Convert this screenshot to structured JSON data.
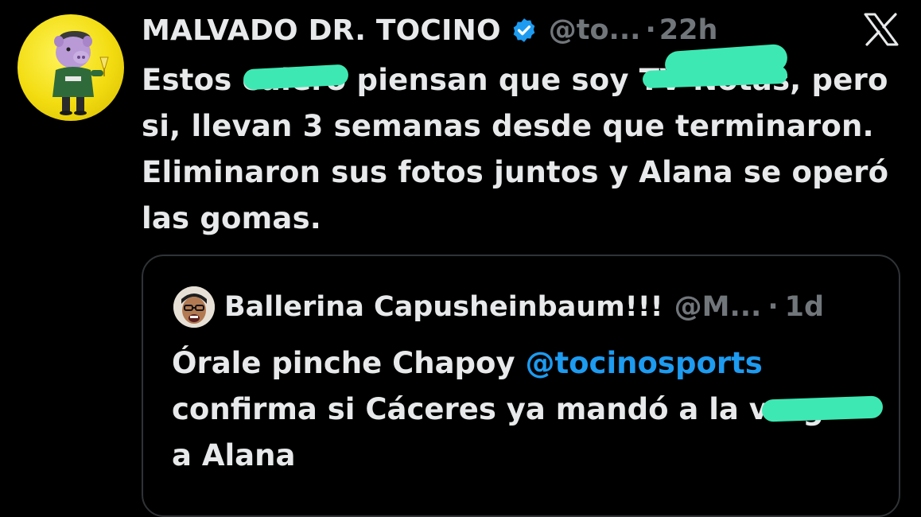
{
  "tweet": {
    "author_name": "MALVADO DR. TOCINO",
    "author_handle": "@to...",
    "separator": "·",
    "time": "22h",
    "verified_icon": "verified-badge-icon",
    "text_lines": [
      "Estos culero piensan que soy TV Notas, pero",
      "si, llevan 3 semanas desde que terminaron.",
      "Eliminaron sus fotos juntos y Alana se operó",
      "las gomas."
    ]
  },
  "platform": {
    "logo_icon": "x-logo-icon"
  },
  "quoted_tweet": {
    "author_name": "Ballerina Capusheinbaum!!!",
    "author_handle": "@M...",
    "separator": "·",
    "time": "1d",
    "text_line1_prefix": "Órale pinche Chapoy ",
    "mention": "@tocinosports",
    "text_line2": "confirma si Cáceres ya mandó a la verga",
    "text_line3": "a Alana"
  },
  "colors": {
    "background": "#000000",
    "primary_text": "#e7e9ea",
    "secondary_text": "#71767b",
    "link": "#1d9bf0",
    "verified": "#1d9bf0",
    "redaction": "#3ee8b2",
    "avatar_bg": "#f2dc10",
    "border": "#2f3336"
  }
}
